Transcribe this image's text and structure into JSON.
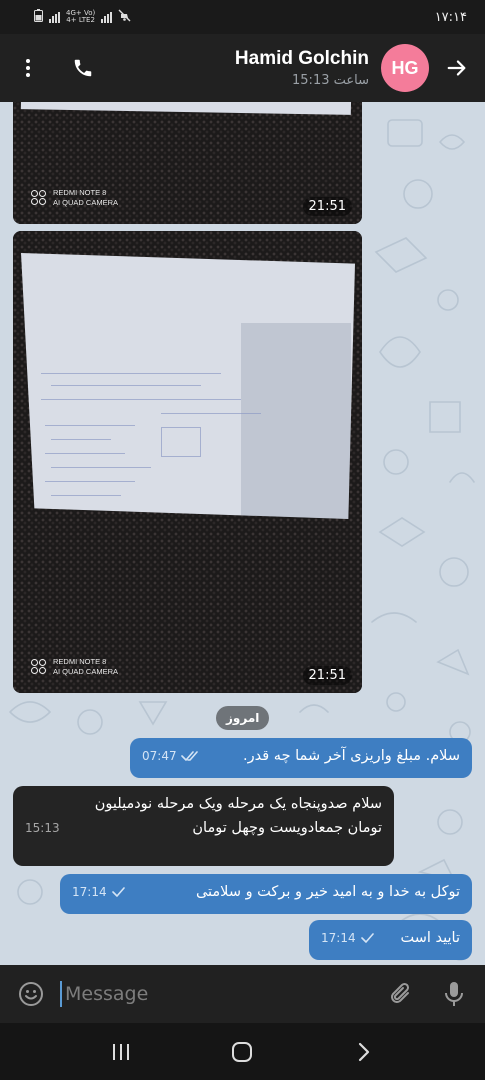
{
  "status_bar": {
    "network_top": "4G+ Vo)",
    "network_bottom": "4+ LTE2",
    "clock": "۱۷:۱۴"
  },
  "header": {
    "contact_name": "Hamid Golchin",
    "last_seen": "ساعت 15:13",
    "avatar_initials": "HG",
    "avatar_color": "#f47c9a"
  },
  "photos": [
    {
      "watermark_model": "REDMI NOTE 8",
      "watermark_camera": "AI QUAD CAMERA",
      "time": "21:51"
    },
    {
      "watermark_model": "REDMI NOTE 8",
      "watermark_camera": "AI QUAD CAMERA",
      "time": "21:51"
    }
  ],
  "date_chip": "امروز",
  "messages": [
    {
      "direction": "out",
      "text": "سلام. مبلغ واریزی آخر شما چه قدر.",
      "time": "07:47",
      "status": "read"
    },
    {
      "direction": "in",
      "text_line1": "سلام صدوپنجاه یک مرحله ویک مرحله نودمیلیون",
      "text_line2": "تومان جمعادویست وچهل تومان",
      "time": "15:13"
    },
    {
      "direction": "out",
      "text": "توکل به خدا و به امید خیر و برکت و سلامتی",
      "time": "17:14",
      "status": "sent"
    },
    {
      "direction": "out",
      "text": "تایید است",
      "time": "17:14",
      "status": "sent"
    }
  ],
  "input": {
    "placeholder": "Message"
  },
  "colors": {
    "outgoing_bubble": "#3e7ec2",
    "incoming_bubble": "#242424",
    "chat_background": "#cfd9e3",
    "header": "#212121"
  }
}
